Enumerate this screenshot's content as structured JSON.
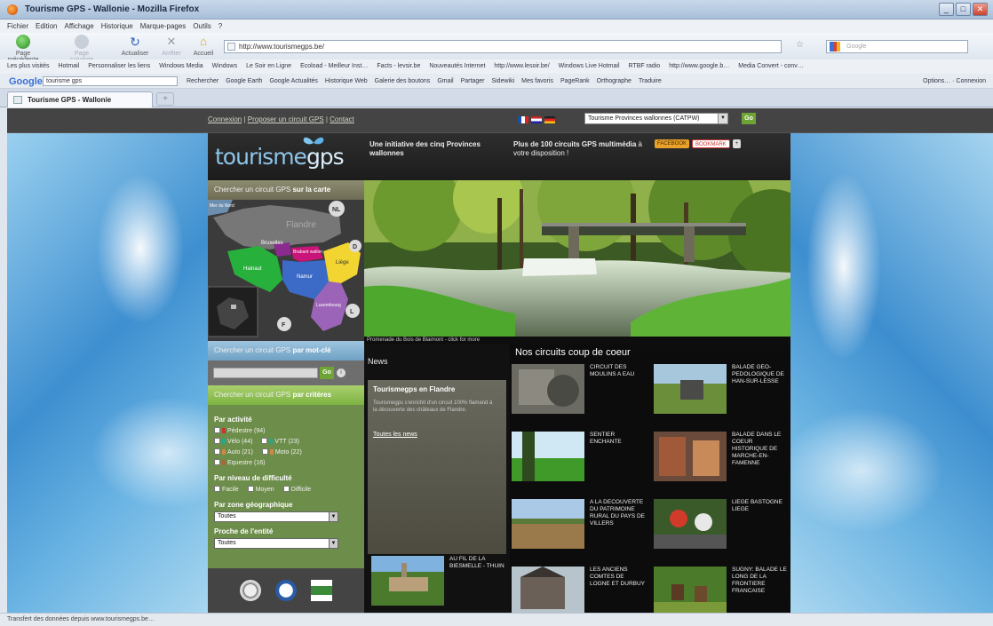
{
  "browser": {
    "title": "Tourisme GPS - Wallonie - Mozilla Firefox",
    "menu": [
      "Fichier",
      "Edition",
      "Affichage",
      "Historique",
      "Marque-pages",
      "Outils",
      "?"
    ],
    "nav": {
      "back": "Page précédente",
      "forward": "Page suivante",
      "reload": "Actualiser",
      "stop": "Arrêter",
      "home": "Accueil"
    },
    "url": "http://www.tourismegps.be/",
    "search_placeholder": "Google",
    "bookmarks": [
      "Les plus visités",
      "Hotmail",
      "Personnaliser les liens",
      "Windows Media",
      "Windows",
      "Le Soir en Ligne",
      "Ecoload - Meilleur Inst…",
      "Facts - levsir.be",
      "Nouveautés Internet",
      "http://www.lesoir.be/",
      "Windows Live Hotmail",
      "RTBF radio",
      "http://www.google.b…",
      "Media Convert - conv…"
    ],
    "google_toolbar": {
      "logo": "Google",
      "query": "tourisme gps",
      "items": [
        "Rechercher",
        "Google Earth",
        "Google Actualités",
        "Historique Web",
        "Galerie des boutons",
        "Gmail",
        "Partager",
        "Sidewiki",
        "Mes favoris",
        "PageRank",
        "Orthographe",
        "Traduire"
      ],
      "right": "Options… · Connexion"
    },
    "tab": "Tourisme GPS - Wallonie",
    "new_tab": "+",
    "status": "Transfert des données depuis www.tourismegps.be…"
  },
  "site": {
    "toplinks": {
      "login": "Connexion",
      "propose": "Proposer un circuit GPS",
      "contact": "Contact",
      "sep": "|"
    },
    "province_select": "Tourisme Provinces wallonnes (CATPW)",
    "go": "Go",
    "logo_a": "tourisme",
    "logo_b": "gps",
    "tagline": "Une initiative des cinq Provinces wallonnes",
    "tag2_bold": "Plus de 100 circuits GPS multimédia",
    "tag2_rest": "à votre disposition !",
    "badges": [
      "FACEBOOK",
      "BOOKMARK",
      "+"
    ],
    "map_search": {
      "prefix": "Chercher un circuit GPS ",
      "bold": "sur la carte"
    },
    "map_labels": {
      "flandre": "Flandre",
      "bruxelles": "Bruxelles",
      "brabant": "Brabant wallon",
      "hainaut": "Hainaut",
      "namur": "Namur",
      "liege": "Liège",
      "luxembourg": "Luxembourg",
      "nl": "NL",
      "d": "D",
      "l": "L",
      "f": "F",
      "mer": "Mer du Nord"
    },
    "keyword_search": {
      "prefix": "Chercher un circuit GPS ",
      "bold": "par mot-clé"
    },
    "info": "i",
    "criteria_search": {
      "prefix": "Chercher un circuit GPS ",
      "bold": "par critères"
    },
    "activity": {
      "title": "Par activité",
      "items": [
        {
          "label": "Pédestre",
          "count": "(94)"
        },
        {
          "label": "Vélo",
          "count": "(44)"
        },
        {
          "label": "VTT",
          "count": "(23)"
        },
        {
          "label": "Auto",
          "count": "(21)"
        },
        {
          "label": "Moto",
          "count": "(22)"
        },
        {
          "label": "Equestre",
          "count": "(16)"
        }
      ]
    },
    "difficulty": {
      "title": "Par niveau de difficulté",
      "items": [
        "Facile",
        "Moyen",
        "Difficile"
      ]
    },
    "zone": {
      "title": "Par zone géographique",
      "value": "Toutes"
    },
    "near": {
      "title": "Proche de l'entité",
      "value": "Toutes"
    },
    "caption": "Promenade du Bois de Blaimont - click for more",
    "news": {
      "title": "News",
      "headline": "Tourismegps en Flandre",
      "text": "Tourismegps s'enrichit d'un circuit 100% flamand à la découverte des châteaux de Flandre.",
      "all": "Toutes les news"
    },
    "featured_title": "Nos circuits coup de coeur",
    "circuits": [
      "CIRCUIT DES MOULINS A EAU",
      "BALADE GEO-PEDOLOGIQUE DE HAN-SUR-LESSE",
      "SENTIER ENCHANTE",
      "BALADE DANS LE COEUR HISTORIQUE DE MARCHE-EN-FAMENNE",
      "A LA DECOUVERTE DU PATRIMOINE RURAL DU PAYS DE VILLERS",
      "LIEGE BASTOGNE LIEGE",
      "AU FIL DE LA BIESMELLE - THUIN",
      "LES ANCIENS COMTES DE LOGNE ET DURBUY",
      "SUGNY: BALADE LE LONG DE LA FRONTIERE FRANCAISE"
    ]
  },
  "colors": {
    "accent_green": "#6fa336",
    "panel_dark": "#111111",
    "sky_blue": "#3e8fd0"
  }
}
